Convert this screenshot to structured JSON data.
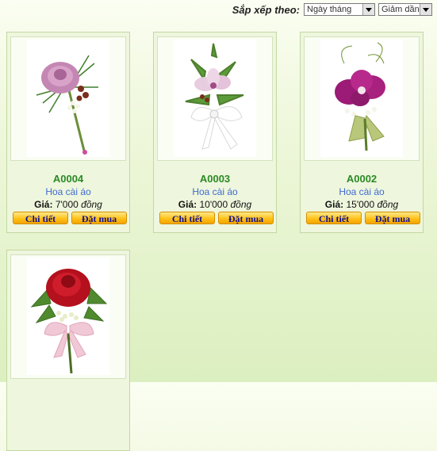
{
  "sort": {
    "label": "Sắp xếp theo:",
    "field_selected": "Ngày tháng",
    "order_selected": "Giảm dần"
  },
  "products": [
    {
      "code": "A0004",
      "name": "Hoa cài áo",
      "price_label": "Giá:",
      "price": "7'000",
      "currency": "đồng",
      "detail_label": "Chi tiết",
      "order_label": "Đặt mua"
    },
    {
      "code": "A0003",
      "name": "Hoa cài áo",
      "price_label": "Giá:",
      "price": "10'000",
      "currency": "đồng",
      "detail_label": "Chi tiết",
      "order_label": "Đặt mua"
    },
    {
      "code": "A0002",
      "name": "Hoa cài áo",
      "price_label": "Giá:",
      "price": "15'000",
      "currency": "đồng",
      "detail_label": "Chi tiết",
      "order_label": "Đặt mua"
    },
    {
      "code": "",
      "name": "",
      "price_label": "",
      "price": "",
      "currency": "",
      "detail_label": "",
      "order_label": ""
    }
  ],
  "colors": {
    "code_green": "#2a8a25",
    "name_blue": "#3f6ad0",
    "button_gold": "#ffc21a",
    "button_text": "#101090"
  }
}
